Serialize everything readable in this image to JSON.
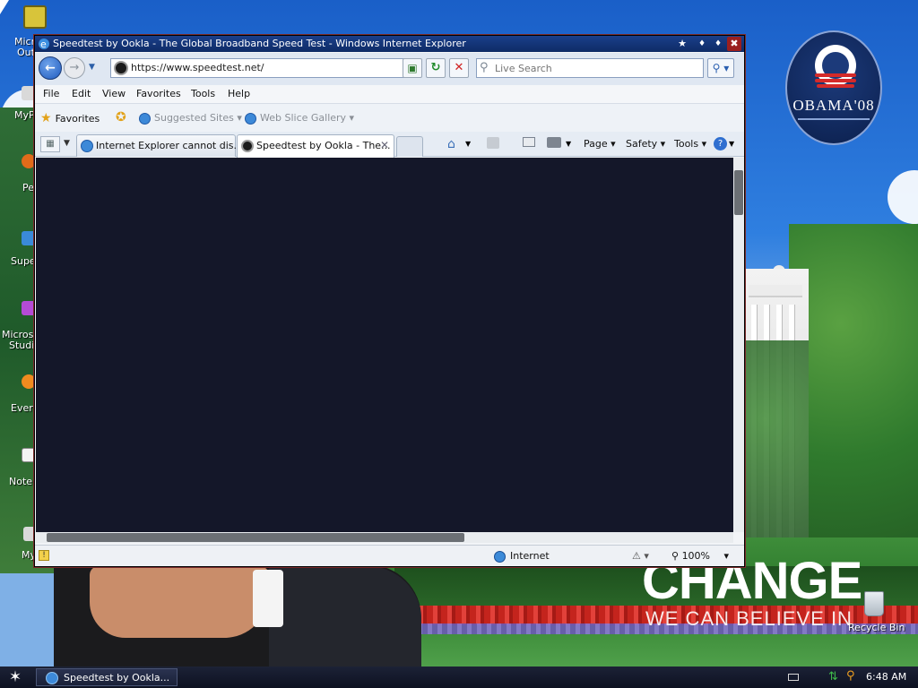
{
  "window": {
    "title": "Speedtest by Ookla - The Global Broadband Speed Test - Windows Internet Explorer",
    "title_buttons": [
      "★",
      "♦",
      "♦",
      "✖"
    ]
  },
  "address_bar": {
    "url": "https://www.speedtest.net/",
    "search_placeholder": "Live Search"
  },
  "menu": {
    "items": [
      "File",
      "Edit",
      "View",
      "Favorites",
      "Tools",
      "Help"
    ]
  },
  "favorites_bar": {
    "favorites_label": "Favorites",
    "links": [
      "Suggested Sites ▾",
      "Web Slice Gallery ▾"
    ]
  },
  "tabs": [
    {
      "label": "Internet Explorer cannot dis...",
      "active": false
    },
    {
      "label": "Speedtest by Ookla - The...",
      "active": true
    }
  ],
  "command_bar": {
    "page": "Page ▾",
    "safety": "Safety ▾",
    "tools": "Tools ▾"
  },
  "status_bar": {
    "zone": "Internet",
    "zoom": "100%",
    "zoom_dropdown": "▾"
  },
  "desktop": {
    "icons": [
      {
        "label": "Micr"
      },
      {
        "label": "Out"
      },
      {
        "label": "MyP"
      },
      {
        "label": "Pe"
      },
      {
        "label": "Supe"
      },
      {
        "label": "Microso"
      },
      {
        "label": "Studi"
      },
      {
        "label": "Every"
      },
      {
        "label": "Notep"
      },
      {
        "label": "My"
      }
    ],
    "recycle_bin": "Recycle Bin",
    "wallpaper_text": {
      "change": "CHANGE",
      "believe": "WE CAN BELIEVE IN",
      "logo": "OBAMA'08"
    }
  },
  "taskbar": {
    "start_glyph": "✶",
    "task_label": "Speedtest by Ookla...",
    "clock": "6:48 AM"
  },
  "colors": {
    "titlebar": "#1a3f8a",
    "page_background": "#141729",
    "close_button": "#9a1f1f"
  }
}
